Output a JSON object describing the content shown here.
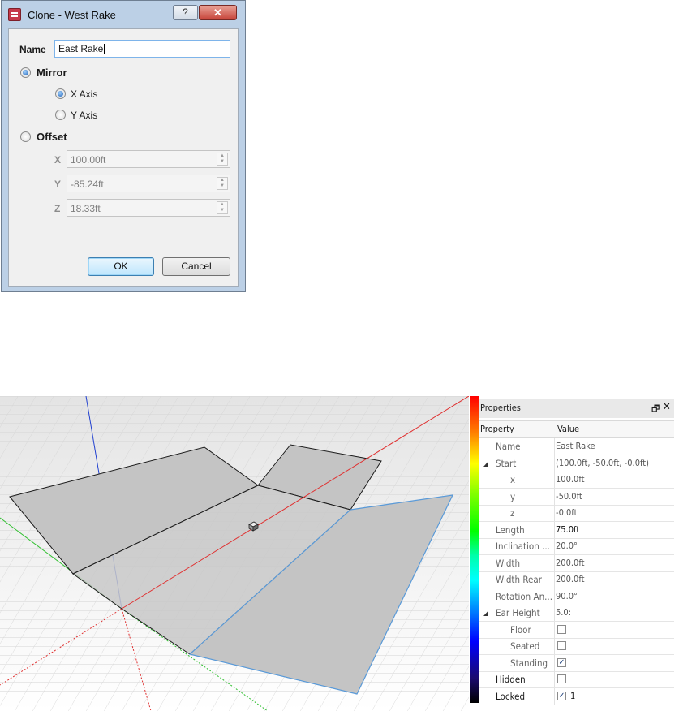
{
  "dialog": {
    "title": "Clone - West Rake",
    "help_label": "?",
    "close_label": "✕",
    "name_label": "Name",
    "name_value": "East Rake",
    "mirror_label": "Mirror",
    "mirror_selected": true,
    "x_axis_label": "X Axis",
    "y_axis_label": "Y Axis",
    "mirror_axis_selected": "X Axis",
    "offset_label": "Offset",
    "offset_selected": false,
    "offset": {
      "x_label": "X",
      "x_value": "100.00ft",
      "y_label": "Y",
      "y_value": "-85.24ft",
      "z_label": "Z",
      "z_value": "18.33ft"
    },
    "ok_label": "OK",
    "cancel_label": "Cancel"
  },
  "viewport": {
    "axis_colors": {
      "x": "#e03030",
      "y": "#30c030",
      "z": "#2030d0"
    },
    "surface_color": "#c4c4c4",
    "selected_outline_color": "#5a9ad8"
  },
  "properties": {
    "title": "Properties",
    "dock_icon": "restore-icon",
    "close_icon": "close-icon",
    "header_property": "Property",
    "header_value": "Value",
    "rows": [
      {
        "key": "Name",
        "value": "East Rake"
      },
      {
        "key": "Start",
        "value": "(100.0ft, -50.0ft, -0.0ft)"
      },
      {
        "key": "x",
        "value": "100.0ft"
      },
      {
        "key": "y",
        "value": "-50.0ft"
      },
      {
        "key": "z",
        "value": "-0.0ft"
      },
      {
        "key": "Length",
        "value": "75.0ft"
      },
      {
        "key": "Inclination ...",
        "value": "20.0°"
      },
      {
        "key": "Width",
        "value": "200.0ft"
      },
      {
        "key": "Width Rear",
        "value": "200.0ft"
      },
      {
        "key": "Rotation An...",
        "value": "90.0°"
      },
      {
        "key": "Ear Height",
        "value": "5.0:"
      },
      {
        "key": "Floor",
        "value": ""
      },
      {
        "key": "Seated",
        "value": ""
      },
      {
        "key": "Standing",
        "value": ""
      },
      {
        "key": "Hidden",
        "value": ""
      },
      {
        "key": "Locked",
        "value": "1"
      }
    ],
    "checks": {
      "floor": false,
      "seated": false,
      "standing": true,
      "hidden": false,
      "locked": true
    }
  }
}
